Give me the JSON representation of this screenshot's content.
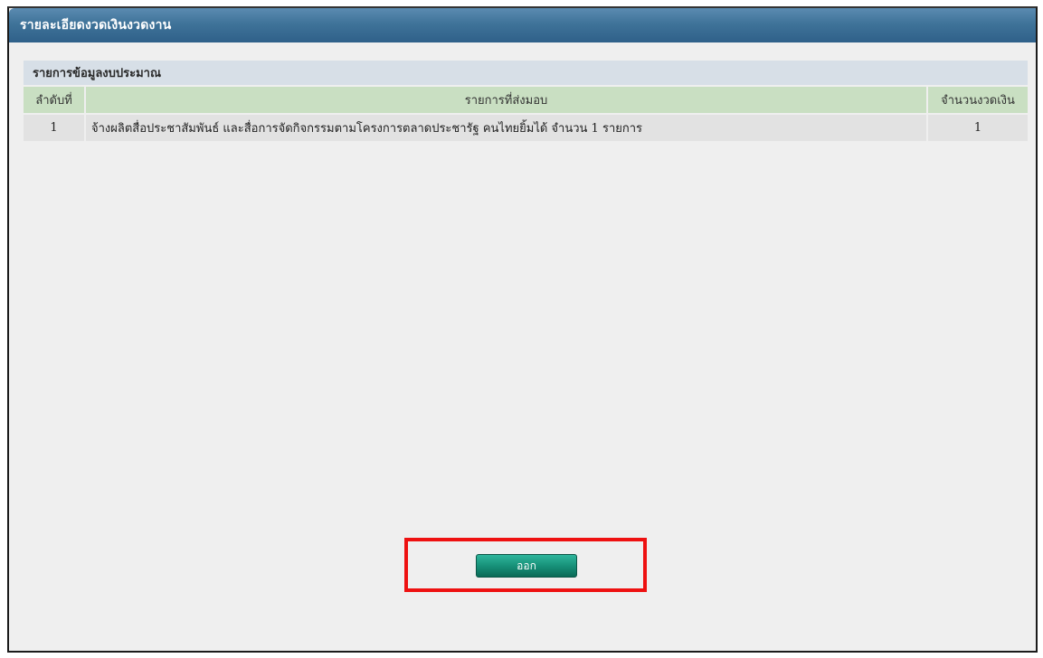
{
  "window": {
    "title": "รายละเอียดงวดเงินงวดงาน"
  },
  "panel": {
    "header": "รายการข้อมูลงบประมาณ",
    "columns": {
      "no": "ลำดับที่",
      "item": "รายการที่ส่งมอบ",
      "count": "จำนวนงวดเงิน"
    },
    "rows": [
      {
        "no": "1",
        "item": "จ้างผลิตสื่อประชาสัมพันธ์ และสื่อการจัดกิจกรรมตามโครงการตลาดประชารัฐ คนไทยยิ้มได้ จำนวน 1 รายการ",
        "count": "1"
      }
    ]
  },
  "actions": {
    "exit_label": "ออก"
  },
  "colors": {
    "titlebar": "#3f7399",
    "header_row": "#c9dfc2",
    "highlight": "#ee1111",
    "button": "#179179",
    "link": "#3d5fa8"
  }
}
